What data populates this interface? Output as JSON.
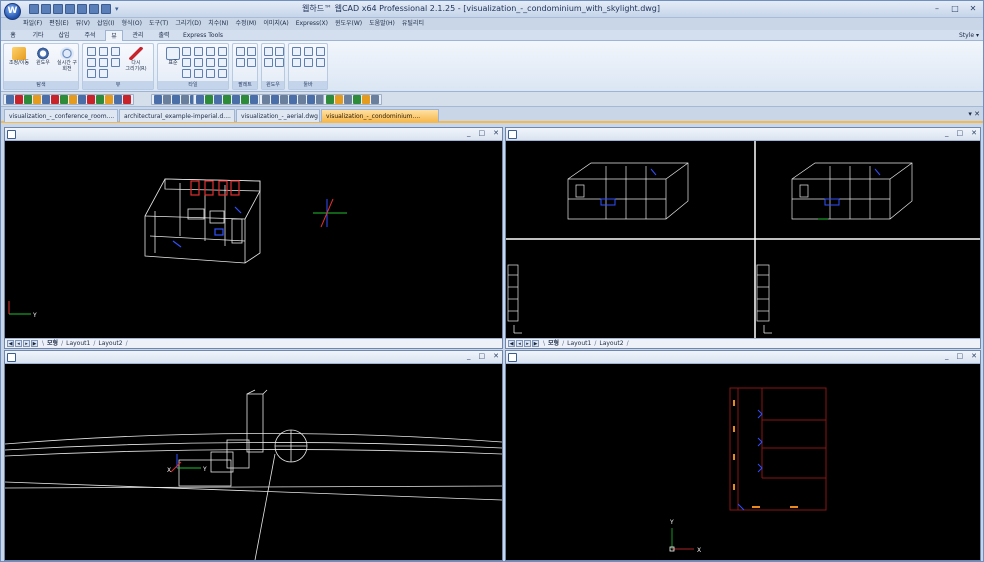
{
  "window": {
    "app_orb": "W",
    "title": "웹하드™ 웹CAD  x64  Professional  2.1.25  -  [visualization_-_condominium_with_skylight.dwg]",
    "quick_access_sep": "▾",
    "controls": [
      "–",
      "□",
      "✕"
    ]
  },
  "menu": [
    "파일(F)",
    "편집(E)",
    "뷰(V)",
    "삽입(I)",
    "형식(O)",
    "도구(T)",
    "그리기(D)",
    "치수(N)",
    "수정(M)",
    "이미지(A)",
    "Express(X)",
    "윈도우(W)",
    "도움말(H)",
    "유틸리티"
  ],
  "ribbon_tabs": [
    {
      "label": "홈",
      "active": false
    },
    {
      "label": "기타",
      "active": false
    },
    {
      "label": "삽입",
      "active": false
    },
    {
      "label": "주석",
      "active": false
    },
    {
      "label": "뷰",
      "active": true
    },
    {
      "label": "관리",
      "active": false
    },
    {
      "label": "출력",
      "active": false
    },
    {
      "label": "Express Tools",
      "active": false
    }
  ],
  "style_label": "Style ▾",
  "ribbon": {
    "nav_group": {
      "label": "탐색",
      "btn1": "조정/이동",
      "btn2": "윈도우",
      "btn3": "실시간 구\n회전"
    },
    "view_group": {
      "label": "뷰",
      "redraw": "다시\n그리기(R)"
    },
    "tile_group": {
      "label": "타일",
      "standard": "표준"
    },
    "palette_group": {
      "label": "팔레트"
    },
    "window_group": {
      "label": "윈도우"
    },
    "toolbar_group": {
      "label": "툴바"
    }
  },
  "doc_tabs": [
    {
      "label": "visualization_-_conference_room....",
      "active": false
    },
    {
      "label": "architectural_example-imperial.d....",
      "active": false
    },
    {
      "label": "visualization_-_aerial.dwg",
      "active": false
    },
    {
      "label": "visualization_-_condominium....",
      "active": true
    }
  ],
  "doc_tabs_ctrl": "▾ ✕",
  "viewport_ctrls": [
    "_",
    "□",
    "✕"
  ],
  "layout_tabs": [
    "모형",
    "Layout1",
    "Layout2"
  ],
  "axis_labels": {
    "x": "X",
    "y": "Y"
  }
}
